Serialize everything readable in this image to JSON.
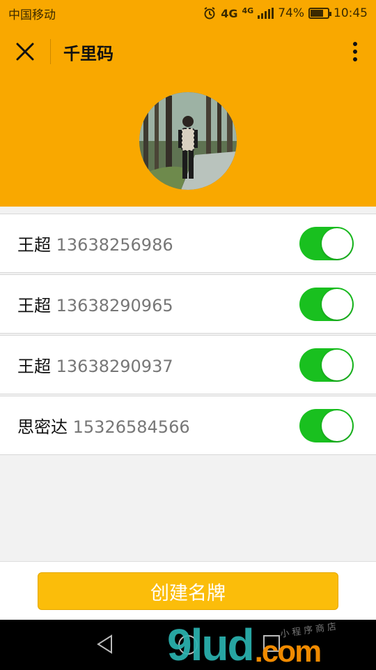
{
  "status_bar": {
    "carrier": "中国移动",
    "network_primary": "4G",
    "network_secondary": "4G",
    "battery": "74%",
    "time": "10:45",
    "icons": [
      "alarm-icon",
      "signal-icon",
      "battery-icon"
    ]
  },
  "nav": {
    "title": "千里码",
    "close_icon": "close-icon",
    "more_icon": "more-vertical-icon"
  },
  "contacts": [
    {
      "name": "王超",
      "phone": "13638256986",
      "enabled": true
    },
    {
      "name": "王超",
      "phone": "13638290965",
      "enabled": true
    },
    {
      "name": "王超",
      "phone": "13638290937",
      "enabled": true
    },
    {
      "name": "思密达",
      "phone": "15326584566",
      "enabled": true
    }
  ],
  "footer": {
    "create_label": "创建名牌"
  },
  "watermark": {
    "brand": "9lud",
    "domain": ".com",
    "tagline": "小程序商店"
  },
  "colors": {
    "header_bg": "#f9a800",
    "toggle_on": "#19c01f",
    "button_bg": "#fbbd0a"
  }
}
